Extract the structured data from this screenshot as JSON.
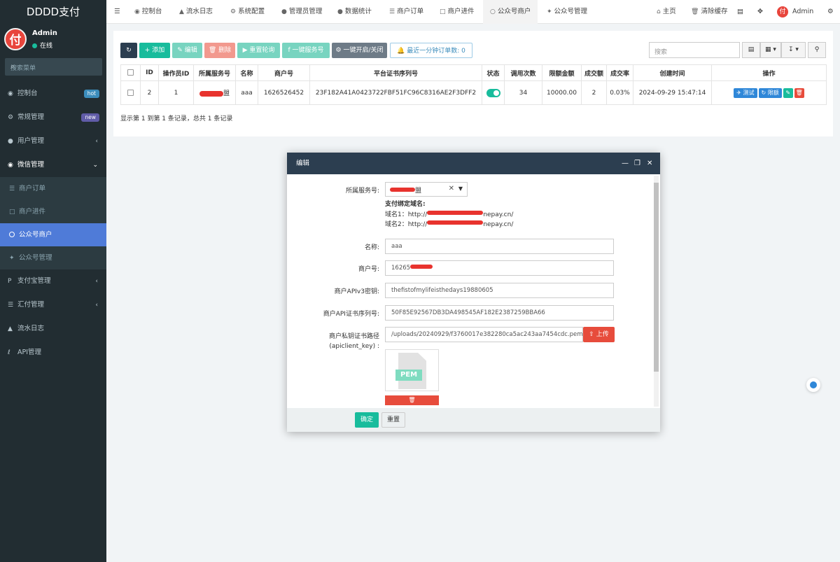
{
  "app": {
    "title": "DDDD支付",
    "logo_char": "付"
  },
  "user": {
    "name": "Admin",
    "status": "在线"
  },
  "sidebar": {
    "search_placeholder": "搜索菜单",
    "items": [
      {
        "label": "控制台",
        "icon": "dashboard-icon",
        "badge": "hot"
      },
      {
        "label": "常规管理",
        "icon": "cogs-icon",
        "badge": "new"
      },
      {
        "label": "用户管理",
        "icon": "users-icon"
      },
      {
        "label": "微信管理",
        "icon": "wechat-icon"
      },
      {
        "label": "商户订单",
        "icon": "list-icon"
      },
      {
        "label": "商户进件",
        "icon": "file-icon"
      },
      {
        "label": "公众号商户",
        "icon": "circle-icon"
      },
      {
        "label": "公众号管理",
        "icon": "wechat-icon"
      },
      {
        "label": "支付宝管理",
        "icon": "paypal-icon"
      },
      {
        "label": "汇付管理",
        "icon": "list-icon"
      },
      {
        "label": "流水日志",
        "icon": "bank-icon"
      },
      {
        "label": "API管理",
        "icon": "paperclip-icon"
      }
    ]
  },
  "topnav": {
    "tabs": [
      "控制台",
      "流水日志",
      "系统配置",
      "管理员管理",
      "数据统计",
      "商户订单",
      "商户进件",
      "公众号商户",
      "公众号管理"
    ],
    "home": "主页",
    "clear_cache": "清除缓存",
    "admin": "Admin"
  },
  "toolbar": {
    "add": "添加",
    "edit": "编辑",
    "delete": "删除",
    "reset_poll": "重置轮询",
    "service": "一键服务号",
    "onekey": "一键开启/关闭",
    "recent_orders": "最近一分钟订单数:",
    "recent_orders_count": "0",
    "search_placeholder": "搜索"
  },
  "table": {
    "headers": [
      "ID",
      "操作员ID",
      "所属服务号",
      "名称",
      "商户号",
      "平台证书序列号",
      "状态",
      "调用次数",
      "限额金额",
      "成交额",
      "成交率",
      "创建时间",
      "操作"
    ],
    "rows": [
      {
        "id": "2",
        "operator_id": "1",
        "service_suffix": "盟",
        "name": "aaa",
        "merchant_no": "1626526452",
        "cert_serial": "23F182A41A0423722FBF51FC96C8316AE2F3DFF2",
        "calls": "34",
        "limit": "10000.00",
        "deals": "2",
        "rate": "0.03%",
        "created": "2024-09-29 15:47:14"
      }
    ],
    "ops": {
      "test": "测试",
      "limit": "限额"
    },
    "pager": "显示第 1 到第 1 条记录，总共 1 条记录"
  },
  "modal": {
    "title": "编辑",
    "fields": {
      "service_label": "所属服务号:",
      "service_value_suffix": "盟",
      "domain_title": "支付绑定域名:",
      "domain1_prefix": "域名1：http://",
      "domain1_suffix": "nepay.cn/",
      "domain2_prefix": "域名2：http://",
      "domain2_suffix": "nepay.cn/",
      "name_label": "名称:",
      "name_value": "aaa",
      "merchant_label": "商户号:",
      "merchant_value": "16265",
      "apiv3_label": "商户APIv3密钥:",
      "apiv3_value": "thefistofmylifeisthedays19880605",
      "serial_label": "商户API证书序列号:",
      "serial_value": "50F85E92567DB3DA498545AF182E2387259BBA66",
      "keypath_label_1": "商户私钥证书路径",
      "keypath_label_2": "(apiclient_key) :",
      "keypath_value": "/uploads/20240929/f3760017e382280ca5ac243aa7454cdc.pem",
      "upload": "上传",
      "pem": "PEM"
    },
    "confirm": "确定",
    "reset": "重置"
  }
}
